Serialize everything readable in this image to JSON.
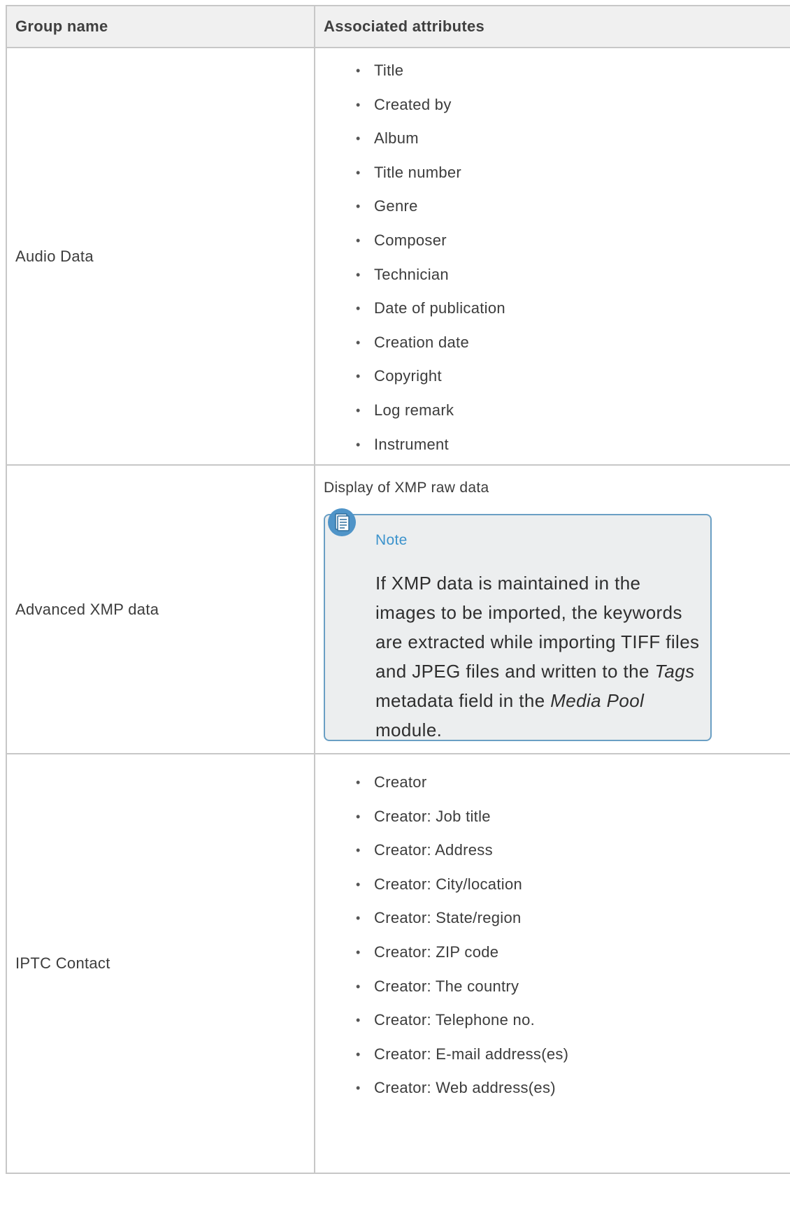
{
  "table": {
    "headers": {
      "group_name": "Group name",
      "associated_attributes": "Associated attributes"
    },
    "rows": [
      {
        "group": "Audio Data",
        "attributes": [
          "Title",
          "Created by",
          "Album",
          "Title number",
          "Genre",
          "Composer",
          "Technician",
          "Date of publication",
          "Creation date",
          "Copyright",
          "Log remark",
          "Instrument"
        ]
      },
      {
        "group": "Advanced XMP data",
        "description": "Display of XMP raw data",
        "note": {
          "title": "Note",
          "text_parts": [
            "If XMP data is maintained in the images to be imported, the keywords are extracted while importing TIFF files and JPEG files and written to the ",
            "Tags",
            " metadata field in the ",
            "Media Pool",
            " module."
          ]
        }
      },
      {
        "group": "IPTC Contact",
        "attributes": [
          "Creator",
          "Creator: Job title",
          "Creator: Address",
          "Creator: City/location",
          "Creator: State/region",
          "Creator: ZIP code",
          "Creator: The country",
          "Creator: Telephone no.",
          "Creator: E-mail address(es)",
          "Creator: Web address(es)"
        ]
      }
    ]
  },
  "icons": {
    "note": "note-document-icon",
    "bullet": "bullet-icon"
  },
  "colors": {
    "border": "#c7c7c7",
    "header_bg": "#f0f0f0",
    "note_border": "#6a9fc4",
    "note_bg": "#eceeef",
    "note_title": "#3c93cc",
    "note_icon": "#4f94c8"
  }
}
